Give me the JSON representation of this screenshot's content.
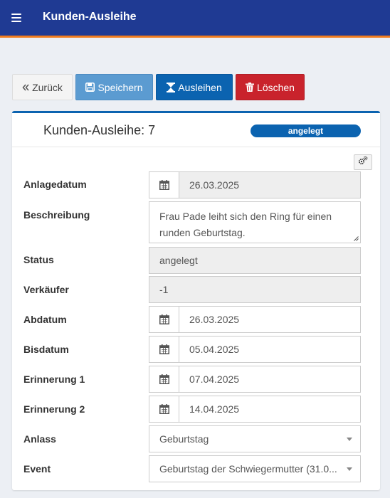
{
  "header": {
    "title": "Kunden-Ausleihe"
  },
  "toolbar": {
    "back_label": "Zurück",
    "save_label": "Speichern",
    "lend_label": "Ausleihen",
    "delete_label": "Löschen"
  },
  "panel": {
    "title": "Kunden-Ausleihe: 7",
    "status_badge": "angelegt"
  },
  "form": {
    "anlagedatum": {
      "label": "Anlagedatum",
      "value": "26.03.2025"
    },
    "beschreibung": {
      "label": "Beschreibung",
      "value": "Frau Pade leiht sich den Ring für einen runden Geburtstag."
    },
    "status": {
      "label": "Status",
      "value": "angelegt"
    },
    "verkaeufer": {
      "label": "Verkäufer",
      "value": "-1"
    },
    "abdatum": {
      "label": "Abdatum",
      "value": "26.03.2025"
    },
    "bisdatum": {
      "label": "Bisdatum",
      "value": "05.04.2025"
    },
    "erinnerung1": {
      "label": "Erinnerung 1",
      "value": "07.04.2025"
    },
    "erinnerung2": {
      "label": "Erinnerung 2",
      "value": "14.04.2025"
    },
    "anlass": {
      "label": "Anlass",
      "value": "Geburtstag"
    },
    "event": {
      "label": "Event",
      "value": "Geburtstag der Schwiegermutter (31.0..."
    }
  },
  "icons": {
    "menu": "hamburger-icon",
    "back": "double-chevron-left-icon",
    "save": "floppy-disk-icon",
    "lend": "hourglass-icon",
    "delete": "trash-icon",
    "tools": "gears-icon",
    "date": "calendar-icon",
    "dropdown": "caret-down-icon"
  },
  "colors": {
    "navbar": "#1f3a93",
    "navbar_accent": "#f07c1e",
    "primary": "#0b63b0",
    "info": "#5b9bd1",
    "danger": "#c9232c"
  }
}
